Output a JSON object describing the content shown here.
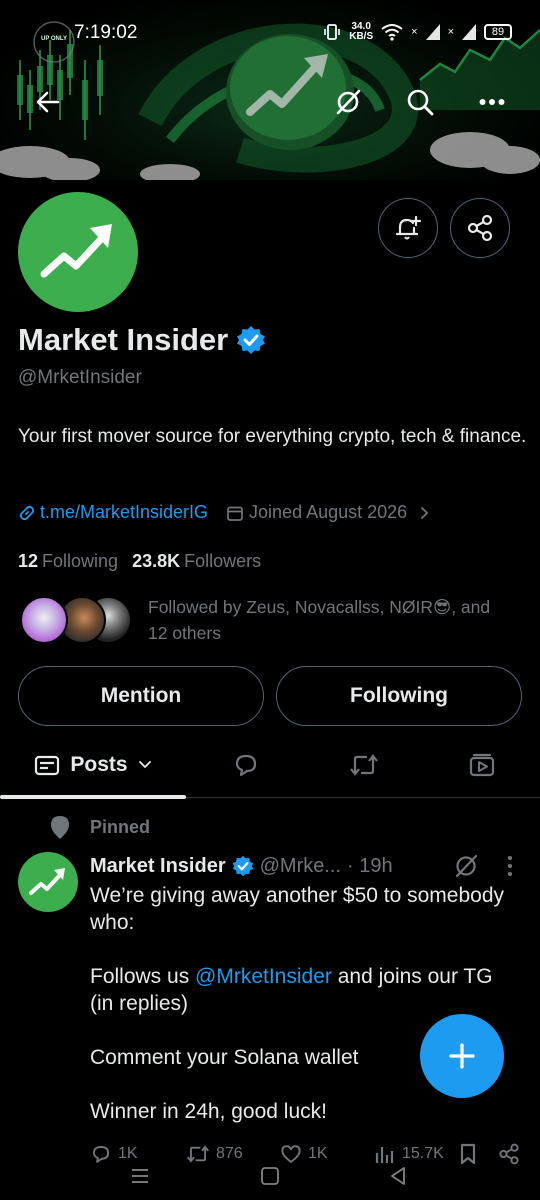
{
  "status_bar": {
    "time": "7:19:02",
    "net_speed_value": "34.0",
    "net_speed_unit": "KB/S",
    "battery": "89"
  },
  "banner_art": {
    "badge_text": "UP ONLY"
  },
  "top_bar": {
    "icons": [
      "back-arrow-icon",
      "grok-icon",
      "search-icon",
      "more-icon"
    ]
  },
  "profile": {
    "name": "Market Insider",
    "handle": "@MrketInsider",
    "bio": "Your first mover source for everything crypto, tech & finance.",
    "link": "t.me/MarketInsiderIG",
    "joined": "Joined August 2026",
    "following_count": "12",
    "following_label": "Following",
    "followers_count": "23.8K",
    "followers_label": "Followers",
    "followed_by": "Followed by Zeus, Novacallss, NØIR😎, and 12 others"
  },
  "buttons": {
    "mention": "Mention",
    "following": "Following"
  },
  "tabs": {
    "posts": "Posts",
    "items": [
      "posts-tab",
      "replies-tab",
      "reposts-tab",
      "media-tab"
    ]
  },
  "post": {
    "pinned_label": "Pinned",
    "author_name": "Market Insider",
    "author_handle": "@Mrke...",
    "time": "· 19h",
    "line1": "We’re giving away another $50 to somebody who:",
    "line2_pre": "Follows us ",
    "line2_mention": "@MrketInsider",
    "line2_post": " and joins our TG (in replies)",
    "line3": "Comment your Solana wallet",
    "line4": "Winner in 24h, good luck!",
    "replies": "1K",
    "reposts": "876",
    "likes": "1K",
    "views": "15.7K"
  },
  "colors": {
    "background": "#000000",
    "accent_blue": "#1d9bf0",
    "brand_green": "#3cae4d",
    "text_primary": "#e7e9ea",
    "text_secondary": "#71767b",
    "border": "#536471"
  }
}
